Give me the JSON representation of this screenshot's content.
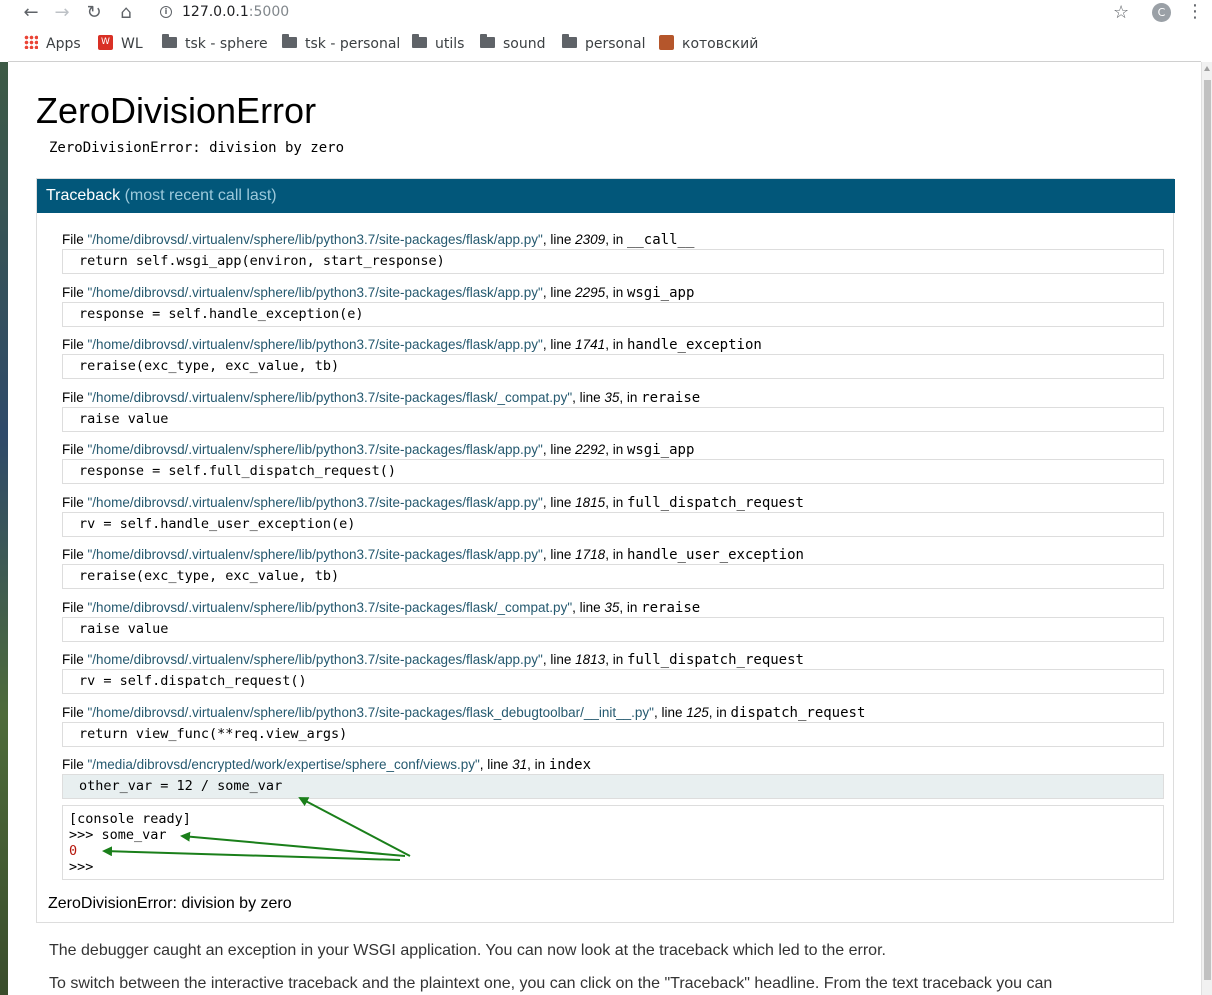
{
  "browser": {
    "url_host": "127.0.0.1",
    "url_port": ":5000",
    "avatar_letter": "C",
    "bookmarks": [
      {
        "label": "Apps",
        "icon": "apps-grid-icon"
      },
      {
        "label": "WL",
        "icon": "wl-favicon-icon"
      },
      {
        "label": "tsk - sphere",
        "icon": "folder-icon"
      },
      {
        "label": "tsk - personal",
        "icon": "folder-icon"
      },
      {
        "label": "utils",
        "icon": "folder-icon"
      },
      {
        "label": "sound",
        "icon": "folder-icon"
      },
      {
        "label": "personal",
        "icon": "folder-icon"
      },
      {
        "label": "котовский",
        "icon": "kotovsky-favicon-icon"
      }
    ]
  },
  "error": {
    "title": "ZeroDivisionError",
    "subtitle": "ZeroDivisionError: division by zero"
  },
  "traceback": {
    "heading": "Traceback",
    "heading_hint": "(most recent call last)",
    "file_prefix": "File ",
    "line_prefix": ", line ",
    "in_prefix": ", in ",
    "frames": [
      {
        "file": "\"/home/dibrovsd/.virtualenv/sphere/lib/python3.7/site-packages/flask/app.py\"",
        "line": "2309",
        "func": "__call__",
        "code": "return self.wsgi_app(environ, start_response)"
      },
      {
        "file": "\"/home/dibrovsd/.virtualenv/sphere/lib/python3.7/site-packages/flask/app.py\"",
        "line": "2295",
        "func": "wsgi_app",
        "code": "response = self.handle_exception(e)"
      },
      {
        "file": "\"/home/dibrovsd/.virtualenv/sphere/lib/python3.7/site-packages/flask/app.py\"",
        "line": "1741",
        "func": "handle_exception",
        "code": "reraise(exc_type, exc_value, tb)"
      },
      {
        "file": "\"/home/dibrovsd/.virtualenv/sphere/lib/python3.7/site-packages/flask/_compat.py\"",
        "line": "35",
        "func": "reraise",
        "code": "raise value"
      },
      {
        "file": "\"/home/dibrovsd/.virtualenv/sphere/lib/python3.7/site-packages/flask/app.py\"",
        "line": "2292",
        "func": "wsgi_app",
        "code": "response = self.full_dispatch_request()"
      },
      {
        "file": "\"/home/dibrovsd/.virtualenv/sphere/lib/python3.7/site-packages/flask/app.py\"",
        "line": "1815",
        "func": "full_dispatch_request",
        "code": "rv = self.handle_user_exception(e)"
      },
      {
        "file": "\"/home/dibrovsd/.virtualenv/sphere/lib/python3.7/site-packages/flask/app.py\"",
        "line": "1718",
        "func": "handle_user_exception",
        "code": "reraise(exc_type, exc_value, tb)"
      },
      {
        "file": "\"/home/dibrovsd/.virtualenv/sphere/lib/python3.7/site-packages/flask/_compat.py\"",
        "line": "35",
        "func": "reraise",
        "code": "raise value"
      },
      {
        "file": "\"/home/dibrovsd/.virtualenv/sphere/lib/python3.7/site-packages/flask/app.py\"",
        "line": "1813",
        "func": "full_dispatch_request",
        "code": "rv = self.dispatch_request()"
      },
      {
        "file": "\"/home/dibrovsd/.virtualenv/sphere/lib/python3.7/site-packages/flask_debugtoolbar/__init__.py\"",
        "line": "125",
        "func": "dispatch_request",
        "code": "return view_func(**req.view_args)"
      },
      {
        "file": "\"/media/dibrovsd/encrypted/work/expertise/sphere_conf/views.py\"",
        "line": "31",
        "func": "index",
        "code": "other_var = 12 / some_var"
      }
    ],
    "console": {
      "ready": "[console ready]",
      "input_line": ">>> some_var",
      "output_line": "0",
      "prompt": ">>>"
    },
    "bottom_error": "ZeroDivisionError: division by zero"
  },
  "explanation": {
    "line1": "The debugger caught an exception in your WSGI application. You can now look at the traceback which led to the error.",
    "line2": "To switch between the interactive traceback and the plaintext one, you can click on the \"Traceback\" headline. From the text traceback you can"
  },
  "colors": {
    "traceback_header_bg": "#02577a",
    "file_link": "#25596f",
    "annotation_arrow": "#1a7f1a"
  }
}
